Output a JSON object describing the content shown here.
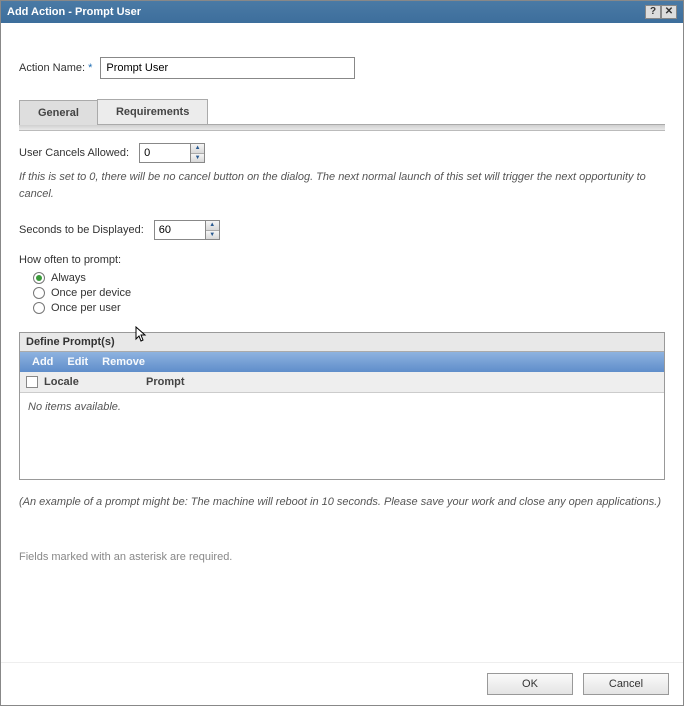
{
  "titlebar": {
    "title": "Add Action - Prompt User"
  },
  "fields": {
    "action_name_label": "Action Name:",
    "action_name_value": "Prompt User"
  },
  "tabs": {
    "general": "General",
    "requirements": "Requirements"
  },
  "general": {
    "cancels_label": "User Cancels Allowed:",
    "cancels_value": "0",
    "cancels_help": "If this is set to 0, there will be no cancel button on the dialog. The next normal launch of this set will trigger the next opportunity to cancel.",
    "seconds_label": "Seconds to be Displayed:",
    "seconds_value": "60",
    "prompt_freq_label": "How often to prompt:",
    "radios": {
      "always": "Always",
      "once_device": "Once per device",
      "once_user": "Once per user"
    },
    "define_header": "Define Prompt(s)",
    "toolbar": {
      "add": "Add",
      "edit": "Edit",
      "remove": "Remove"
    },
    "columns": {
      "locale": "Locale",
      "prompt": "Prompt"
    },
    "empty_text": "No items available.",
    "example_note": "(An example of a prompt might be: The machine will reboot in 10 seconds. Please save your work and close any open applications.)"
  },
  "footer": {
    "required_note": "Fields marked with an asterisk are required.",
    "ok": "OK",
    "cancel": "Cancel"
  }
}
